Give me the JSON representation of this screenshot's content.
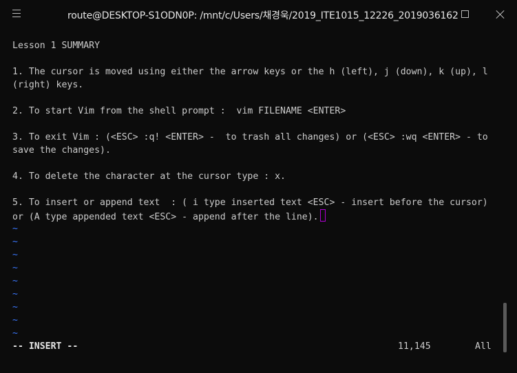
{
  "window": {
    "title": "route@DESKTOP-S1ODN0P: /mnt/c/Users/채경욱/2019_ITE1015_12226_2019036162"
  },
  "editor": {
    "lines": [
      "Lesson 1 SUMMARY",
      "",
      "1. The cursor is moved using either the arrow keys or the h (left), j (down), k (up), l",
      "(right) keys.",
      "",
      "2. To start Vim from the shell prompt :  vim FILENAME <ENTER>",
      "",
      "3. To exit Vim : (<ESC> :q! <ENTER> -  to trash all changes) or (<ESC> :wq <ENTER> - to",
      "save the changes).",
      "",
      "4. To delete the character at the cursor type : x.",
      "",
      "5. To insert or append text  : ( i type inserted text <ESC> - insert before the cursor)",
      "or (A type appended text <ESC> - append after the line)."
    ],
    "tilde": "~"
  },
  "status": {
    "mode": "-- INSERT --",
    "position": "11,145",
    "scroll": "All"
  },
  "colors": {
    "background": "#0c0c0c",
    "text": "#cccccc",
    "tilde": "#3b78ff",
    "cursor_border": "#b000d4"
  }
}
